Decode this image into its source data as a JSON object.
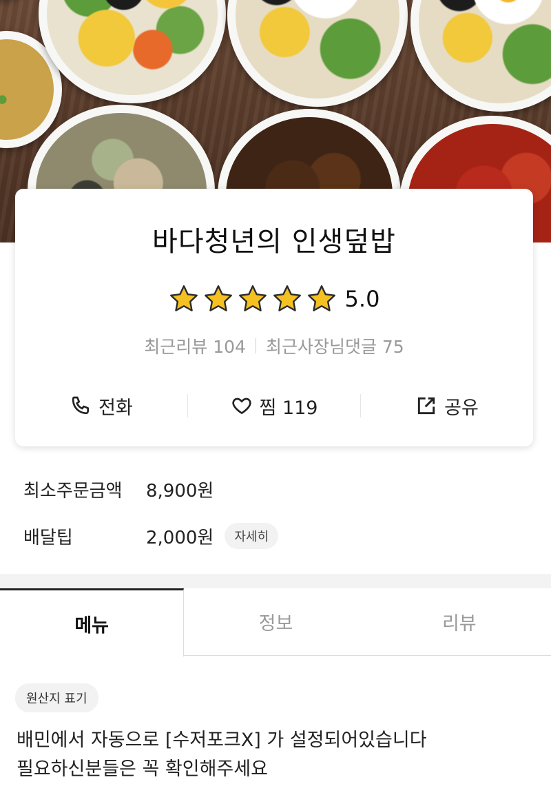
{
  "store": {
    "name": "바다청년의 인생덮밥",
    "rating": "5.0",
    "stars": 5,
    "recent_reviews": "최근리뷰 104",
    "owner_replies": "최근사장님댓글 75"
  },
  "actions": {
    "call_label": "전화",
    "like_label": "찜 119",
    "share_label": "공유"
  },
  "delivery": {
    "min_order_label": "최소주문금액",
    "min_order_value": "8,900원",
    "tip_label": "배달팁",
    "tip_value": "2,000원",
    "detail_label": "자세히"
  },
  "tabs": [
    {
      "label": "메뉴",
      "active": true
    },
    {
      "label": "정보",
      "active": false
    },
    {
      "label": "리뷰",
      "active": false
    }
  ],
  "notice": {
    "origin_chip": "원산지 표기",
    "line1": "배민에서 자동으로 [수저포크X] 가 설정되어있습니다",
    "line2": "필요하신분들은 꼭 확인해주세요"
  },
  "colors": {
    "star": "#f5c021",
    "star_outline": "#2a2a2a",
    "muted_text": "#999999",
    "active_tab_border": "#222222"
  },
  "icons": [
    "phone-icon",
    "heart-icon",
    "share-icon",
    "star-icon"
  ]
}
